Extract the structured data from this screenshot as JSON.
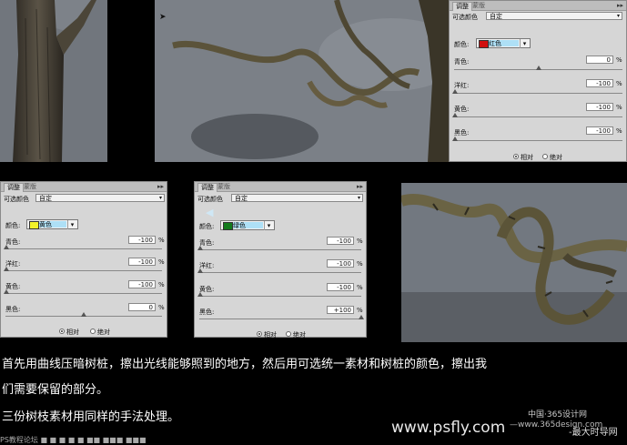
{
  "panel_tabs": {
    "adjust": "调整",
    "mask": "蒙版"
  },
  "panel_menu": "▸▸",
  "common": {
    "preset_label": "可选颜色",
    "preset_value": "自定",
    "color_label": "颜色:",
    "cyan": "青色:",
    "magenta": "洋红:",
    "yellow": "黄色:",
    "black": "黑色:",
    "pct": "%",
    "relative": "相对",
    "absolute": "绝对"
  },
  "panel_red": {
    "color_name": "红色",
    "swatch": "#d10f0f",
    "cyan": "0",
    "magenta": "-100",
    "yellow": "-100",
    "black": "-100"
  },
  "panel_yellow": {
    "color_name": "黄色",
    "swatch": "#f2f22a",
    "cyan": "-100",
    "magenta": "-100",
    "yellow": "-100",
    "black": "0"
  },
  "panel_green": {
    "color_name": "绿色",
    "swatch": "#127a1c",
    "cyan": "-100",
    "magenta": "-100",
    "yellow": "-100",
    "black": "+100"
  },
  "caption": {
    "line1": "首先用曲线压暗树桩，擦出光线能够照到的地方，然后用可选统一素材和树桩的颜色，擦出我",
    "line2": "们需要保留的部分。",
    "line3": "三份树枝素材用同样的手法处理。"
  },
  "watermark": {
    "url": "www.psfly.com",
    "site": "中国·365设计网",
    "sub": "—www.365design.com",
    "brand": "-最大时导网",
    "bottom": "PS教程论坛 ■ ■ ■ ■ ■ ■■ ■■■ ■■■"
  }
}
